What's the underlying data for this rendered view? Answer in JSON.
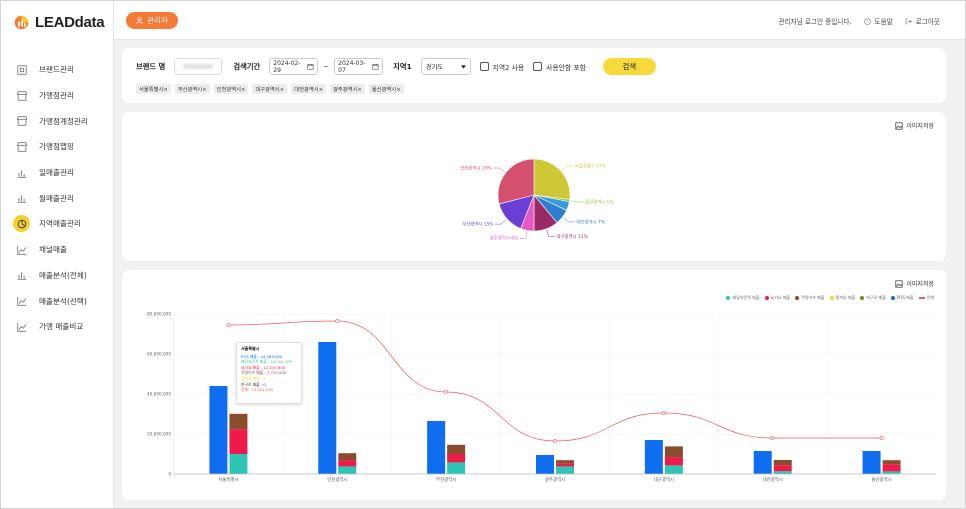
{
  "app": {
    "logo": "LEADdata"
  },
  "sidebar": {
    "items": [
      {
        "label": "브랜드관리",
        "icon": "store-icon",
        "active": false
      },
      {
        "label": "가맹점관리",
        "icon": "shop-icon",
        "active": false
      },
      {
        "label": "가맹점계정관리",
        "icon": "shop-icon",
        "active": false
      },
      {
        "label": "가맹점맵핑",
        "icon": "shop-icon",
        "active": false
      },
      {
        "label": "일매출관리",
        "icon": "chart-icon",
        "active": false
      },
      {
        "label": "월매출관리",
        "icon": "chart-icon",
        "active": false
      },
      {
        "label": "지역매출관리",
        "icon": "pie-chart-icon",
        "active": true
      },
      {
        "label": "채널매출",
        "icon": "line-chart-icon",
        "active": false
      },
      {
        "label": "매출분석(전체)",
        "icon": "chart-icon",
        "active": false
      },
      {
        "label": "매출분석(선택)",
        "icon": "line-chart-icon",
        "active": false
      },
      {
        "label": "가맹 매출비교",
        "icon": "line-chart-icon",
        "active": false
      }
    ]
  },
  "header": {
    "role": "관리자",
    "login_status": "관리자님 로그인 중입니다.",
    "help": "도움말",
    "logout": "로그아웃"
  },
  "filter": {
    "brand_label": "브랜드 명",
    "period_label": "검색기간",
    "date_from": "2024-02-29",
    "date_to": "2024-03-07",
    "region_label": "지역1",
    "region_value": "경기도",
    "region2_label": "지역2 사용",
    "include_unused_label": "사용안함 포함",
    "search_label": "검색",
    "tags": [
      "서울특별시×",
      "부산광역시×",
      "인천광역시×",
      "대구광역시×",
      "대전광역시×",
      "광주광역시×",
      "울산광역시×"
    ]
  },
  "pie_card": {
    "save_label": "이미지저장"
  },
  "pie": {
    "slices": [
      {
        "label": "서울특별시 27%",
        "value": 27,
        "color": "#cdc834"
      },
      {
        "label": "울산광역시 1%",
        "value": 1,
        "color": "#8dc63f"
      },
      {
        "label": "",
        "value": 4,
        "color": "#3a9ad9"
      },
      {
        "label": "대전광역시 7%",
        "value": 7,
        "color": "#2f7fd1"
      },
      {
        "label": "대구광역시 11%",
        "value": 11,
        "color": "#9a2a63"
      },
      {
        "label": "광주광역시 6%",
        "value": 6,
        "color": "#e659c4"
      },
      {
        "label": "부산광역시 15%",
        "value": 15,
        "color": "#6a3fd6"
      },
      {
        "label": "인천광역시 29%",
        "value": 29,
        "color": "#d5506f"
      }
    ]
  },
  "bar_card": {
    "save_label": "이미지저장"
  },
  "chart_data": {
    "type": "bar",
    "legend": [
      {
        "name": "배달의민족 매출",
        "color": "#2ec4b6"
      },
      {
        "name": "요기요 매출",
        "color": "#ee1a4c"
      },
      {
        "name": "쿠팡이츠 매출",
        "color": "#8b4c2c"
      },
      {
        "name": "땡겨요 매출",
        "color": "#f2d43a"
      },
      {
        "name": "마구로 매출",
        "color": "#6a8f1f"
      },
      {
        "name": "POS 매출",
        "color": "#0f6ef0"
      },
      {
        "name": "전체",
        "color": "#f05a5a"
      }
    ],
    "categories": [
      "서울특별시",
      "인천광역시",
      "부산광역시",
      "광주광역시",
      "대구광역시",
      "대전광역시",
      "울산광역시"
    ],
    "y_ticks": [
      "0",
      "20,000,000",
      "40,000,000",
      "60,000,000",
      "80,000,000"
    ],
    "ylim": [
      0,
      80000000
    ],
    "pos": [
      44000000,
      66000000,
      26500000,
      9500000,
      17000000,
      11500000,
      11500000
    ],
    "stack": {
      "baemin": [
        10000000,
        3800000,
        5800000,
        3800000,
        4300000,
        1400000,
        1300000
      ],
      "yogiyo": [
        12400000,
        3000000,
        4200000,
        1600000,
        4000000,
        3000000,
        3600000
      ],
      "coupang": [
        7700000,
        3600000,
        4600000,
        1500000,
        5500000,
        2600000,
        2000000
      ]
    },
    "total_line": [
      74500000,
      76500000,
      41000000,
      16500000,
      30500000,
      18000000,
      18000000
    ],
    "tooltip": {
      "title": "서울특별시",
      "lines": [
        {
          "text": "POS 매출 : 44,099,000",
          "color": "#0f6ef0"
        },
        {
          "text": "배달의민족 매출 : 10,001,705",
          "color": "#2ec4b6"
        },
        {
          "text": "요기요 매출 : 12,447,600",
          "color": "#ee1a4c"
        },
        {
          "text": "쿠팡이츠 매출 : 7,733,000",
          "color": "#8b4c2c"
        },
        {
          "text": "땡겨요 매출 : 0",
          "color": "#f2d43a"
        },
        {
          "text": "마구로 매출 : 0",
          "color": "#333333"
        },
        {
          "text": "전체 : 74,521,000",
          "color": "#f05a5a"
        }
      ]
    }
  }
}
